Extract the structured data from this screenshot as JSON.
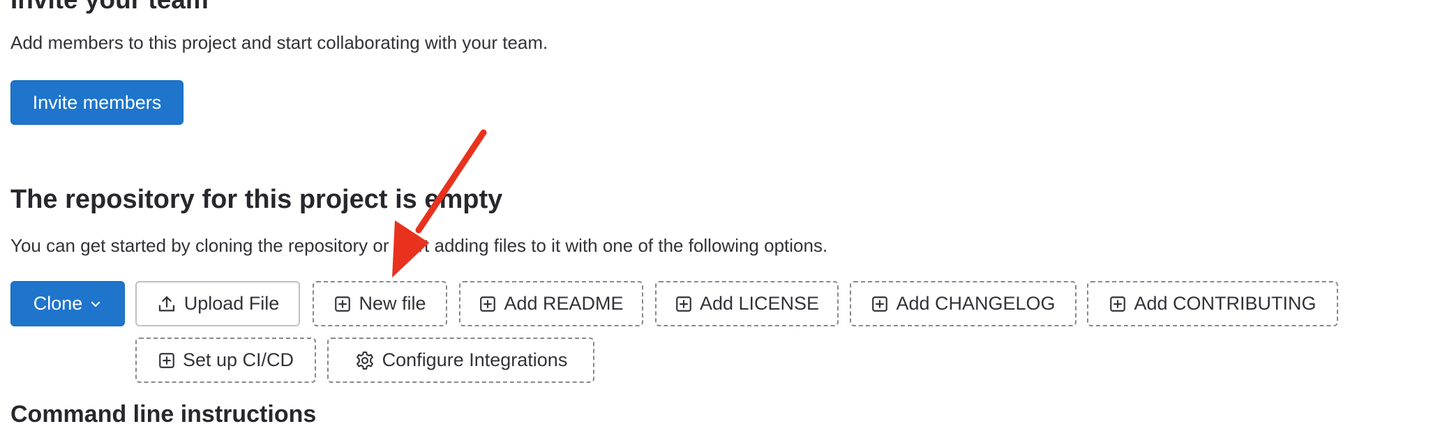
{
  "invite": {
    "title": "Invite your team",
    "description": "Add members to this project and start collaborating with your team.",
    "button_label": "Invite members"
  },
  "repository": {
    "title": "The repository for this project is empty",
    "description": "You can get started by cloning the repository or start adding files to it with one of the following options."
  },
  "actions": {
    "clone": {
      "label": "Clone",
      "icon": "chevron-down-icon"
    },
    "upload_file": {
      "label": "Upload File",
      "icon": "upload-icon"
    },
    "new_file": {
      "label": "New file",
      "icon": "plus-square-icon"
    },
    "add_readme": {
      "label": "Add README",
      "icon": "plus-square-icon"
    },
    "add_license": {
      "label": "Add LICENSE",
      "icon": "plus-square-icon"
    },
    "add_changelog": {
      "label": "Add CHANGELOG",
      "icon": "plus-square-icon"
    },
    "add_contributing": {
      "label": "Add CONTRIBUTING",
      "icon": "plus-square-icon"
    },
    "setup_cicd": {
      "label": "Set up CI/CD",
      "icon": "plus-square-icon"
    },
    "configure_integrations": {
      "label": "Configure Integrations",
      "icon": "gear-icon"
    }
  },
  "command_line": {
    "title": "Command line instructions"
  },
  "colors": {
    "primary": "#1f75cb",
    "annotation_arrow": "#e8321e",
    "text": "#333238"
  }
}
